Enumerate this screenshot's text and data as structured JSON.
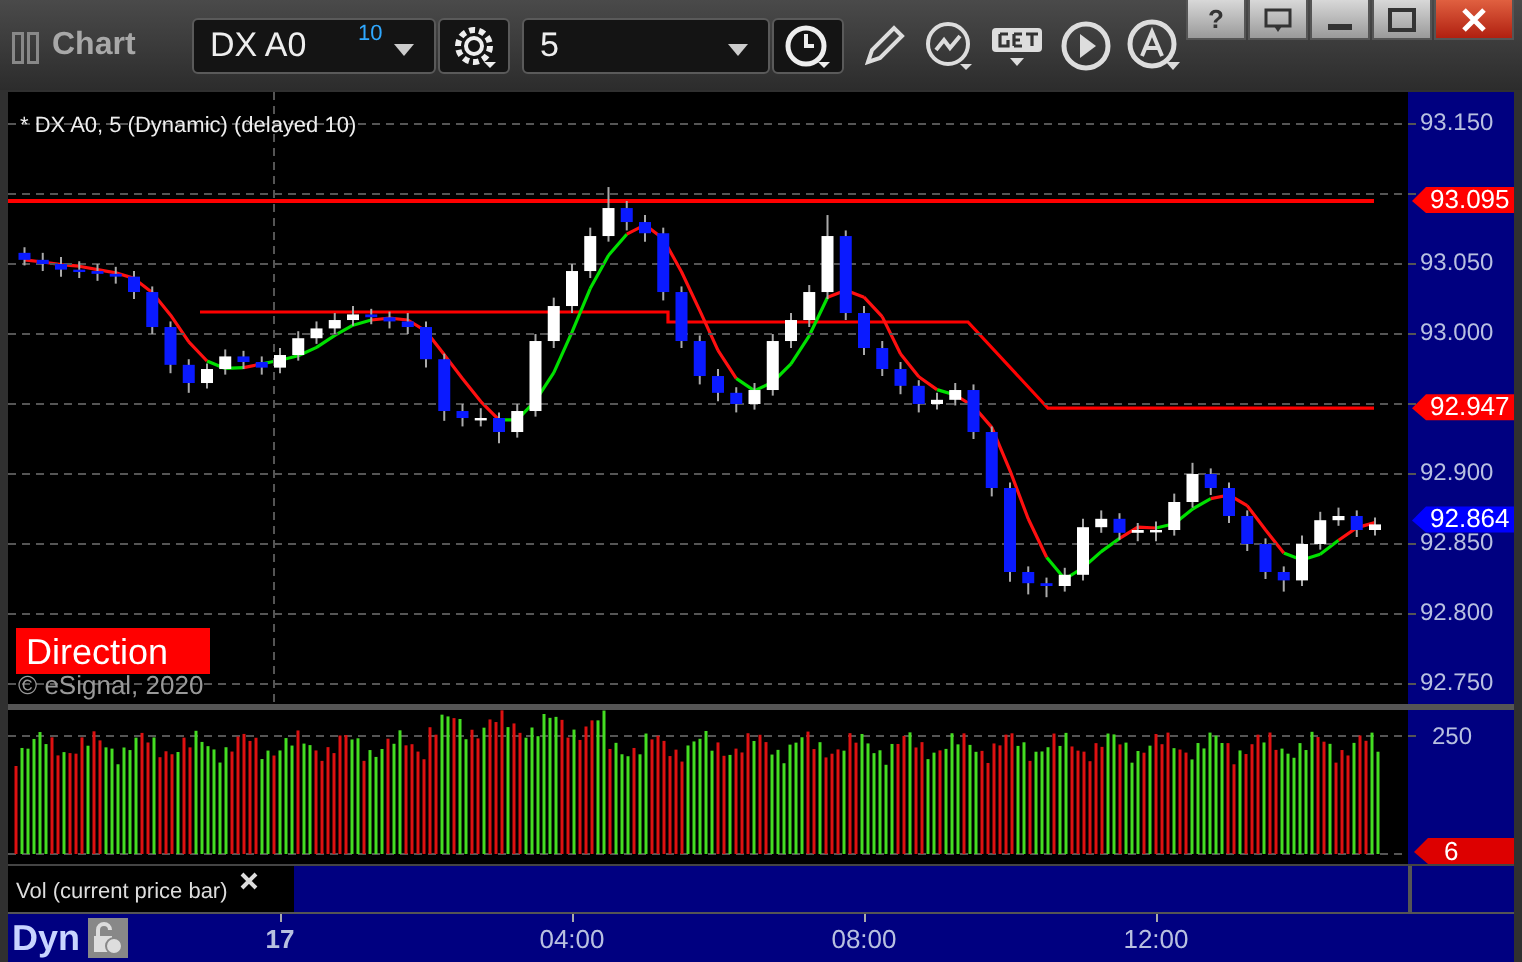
{
  "window": {
    "title": "Chart",
    "help": "?"
  },
  "toolbar": {
    "symbol": {
      "value": "DX A0",
      "badge": "10"
    },
    "interval": {
      "value": "5"
    }
  },
  "price_pane": {
    "legend": "* DX A0, 5 (Dynamic) (delayed 10)",
    "chart_data": {
      "type": "candlestick",
      "categories": [
        null,
        null,
        null,
        null,
        null,
        null,
        null,
        null,
        null,
        null,
        null,
        null,
        null,
        null,
        null,
        null,
        null,
        null,
        null,
        null,
        null,
        null,
        null,
        null,
        null,
        null,
        null,
        null,
        null,
        null,
        null,
        null,
        null,
        null,
        null,
        null,
        null,
        null,
        null,
        null,
        null,
        null,
        null,
        null,
        null,
        null,
        null,
        null,
        null,
        null,
        null,
        null,
        null,
        null,
        null,
        null,
        null,
        null,
        null,
        null,
        null,
        null,
        null,
        null,
        null,
        null,
        null,
        null,
        null,
        null,
        null,
        null,
        null,
        null,
        null
      ],
      "grid": true,
      "ohlc": [
        [
          93.058,
          93.062,
          93.049,
          93.053
        ],
        [
          93.053,
          93.058,
          93.045,
          93.05
        ],
        [
          93.05,
          93.055,
          93.041,
          93.046
        ],
        [
          93.046,
          93.052,
          93.04,
          93.045
        ],
        [
          93.045,
          93.05,
          93.038,
          93.043
        ],
        [
          93.043,
          93.048,
          93.036,
          93.041
        ],
        [
          93.041,
          93.045,
          93.025,
          93.03
        ],
        [
          93.03,
          93.034,
          93.0,
          93.005
        ],
        [
          93.005,
          93.009,
          92.972,
          92.978
        ],
        [
          92.978,
          92.982,
          92.958,
          92.965
        ],
        [
          92.965,
          92.979,
          92.961,
          92.975
        ],
        [
          92.975,
          92.989,
          92.971,
          92.984
        ],
        [
          92.984,
          92.988,
          92.975,
          92.98
        ],
        [
          92.98,
          92.984,
          92.971,
          92.976
        ],
        [
          92.976,
          92.99,
          92.972,
          92.985
        ],
        [
          92.985,
          93.002,
          92.981,
          92.997
        ],
        [
          92.997,
          93.009,
          92.993,
          93.004
        ],
        [
          93.004,
          93.015,
          93.0,
          93.01
        ],
        [
          93.01,
          93.02,
          93.006,
          93.014
        ],
        [
          93.014,
          93.018,
          93.007,
          93.012
        ],
        [
          93.012,
          93.016,
          93.004,
          93.009
        ],
        [
          93.009,
          93.015,
          93.0,
          93.005
        ],
        [
          93.005,
          93.009,
          92.976,
          92.982
        ],
        [
          92.982,
          92.986,
          92.938,
          92.945
        ],
        [
          92.945,
          92.95,
          92.934,
          92.94
        ],
        [
          92.94,
          92.947,
          92.934,
          92.94
        ],
        [
          92.94,
          92.944,
          92.922,
          92.93
        ],
        [
          92.93,
          92.95,
          92.926,
          92.945
        ],
        [
          92.945,
          93.0,
          92.941,
          92.995
        ],
        [
          92.995,
          93.026,
          92.99,
          93.02
        ],
        [
          93.02,
          93.05,
          93.015,
          93.045
        ],
        [
          93.045,
          93.076,
          93.04,
          93.07
        ],
        [
          93.07,
          93.105,
          93.066,
          93.09
        ],
        [
          93.09,
          93.095,
          93.074,
          93.08
        ],
        [
          93.08,
          93.085,
          93.066,
          93.072
        ],
        [
          93.072,
          93.076,
          93.024,
          93.03
        ],
        [
          93.03,
          93.034,
          92.99,
          92.995
        ],
        [
          92.995,
          92.999,
          92.964,
          92.97
        ],
        [
          92.97,
          92.975,
          92.952,
          92.958
        ],
        [
          92.958,
          92.962,
          92.944,
          92.95
        ],
        [
          92.95,
          92.965,
          92.946,
          92.96
        ],
        [
          92.96,
          93.0,
          92.956,
          92.995
        ],
        [
          92.995,
          93.015,
          92.99,
          93.01
        ],
        [
          93.01,
          93.035,
          93.005,
          93.03
        ],
        [
          93.03,
          93.085,
          93.025,
          93.07
        ],
        [
          93.07,
          93.074,
          93.01,
          93.015
        ],
        [
          93.015,
          93.02,
          92.985,
          92.99
        ],
        [
          92.99,
          92.995,
          92.97,
          92.975
        ],
        [
          92.975,
          92.98,
          92.957,
          92.963
        ],
        [
          92.963,
          92.967,
          92.944,
          92.95
        ],
        [
          92.95,
          92.958,
          92.946,
          92.953
        ],
        [
          92.953,
          92.965,
          92.949,
          92.96
        ],
        [
          92.96,
          92.964,
          92.925,
          92.93
        ],
        [
          92.93,
          92.934,
          92.884,
          92.89
        ],
        [
          92.89,
          92.894,
          92.823,
          92.83
        ],
        [
          92.83,
          92.834,
          92.814,
          92.822
        ],
        [
          92.822,
          92.826,
          92.812,
          92.82
        ],
        [
          92.82,
          92.833,
          92.816,
          92.828
        ],
        [
          92.828,
          92.868,
          92.824,
          92.862
        ],
        [
          92.862,
          92.874,
          92.858,
          92.868
        ],
        [
          92.868,
          92.872,
          92.853,
          92.858
        ],
        [
          92.858,
          92.865,
          92.852,
          92.86
        ],
        [
          92.86,
          92.866,
          92.852,
          92.86
        ],
        [
          92.86,
          92.886,
          92.856,
          92.88
        ],
        [
          92.88,
          92.908,
          92.876,
          92.9
        ],
        [
          92.9,
          92.904,
          92.885,
          92.89
        ],
        [
          92.89,
          92.894,
          92.865,
          92.87
        ],
        [
          92.87,
          92.874,
          92.845,
          92.85
        ],
        [
          92.85,
          92.854,
          92.825,
          92.83
        ],
        [
          92.83,
          92.834,
          92.816,
          92.824
        ],
        [
          92.824,
          92.856,
          92.82,
          92.85
        ],
        [
          92.85,
          92.873,
          92.846,
          92.867
        ],
        [
          92.867,
          92.876,
          92.863,
          92.87
        ],
        [
          92.87,
          92.874,
          92.855,
          92.86
        ],
        [
          92.86,
          92.869,
          92.856,
          92.864
        ]
      ],
      "yticks": [
        {
          "value": 93.15,
          "label": "93.150"
        },
        {
          "value": 93.05,
          "label": "93.050"
        },
        {
          "value": 93.0,
          "label": "93.000"
        },
        {
          "value": 92.9,
          "label": "92.900"
        },
        {
          "value": 92.85,
          "label": "92.850"
        },
        {
          "value": 92.8,
          "label": "92.800"
        },
        {
          "value": 92.75,
          "label": "92.750"
        }
      ],
      "ylim": [
        92.7357,
        93.1729
      ]
    },
    "price_tags": [
      {
        "label": "93.095",
        "color": "#ff0000"
      },
      {
        "label": "92.947",
        "color": "#ff0000"
      },
      {
        "label": "92.864",
        "color": "#0000ff"
      }
    ],
    "direction_label": "Direction",
    "copyright": "© eSignal, 2020"
  },
  "volume_pane": {
    "ticks": [
      "250"
    ],
    "tag": {
      "label": "6",
      "color": "#dd0000"
    },
    "legend": "Vol (current price bar)"
  },
  "time_axis": {
    "mode": "Dyn",
    "day_label": "17",
    "labels": [
      "04:00",
      "08:00",
      "12:00"
    ]
  }
}
